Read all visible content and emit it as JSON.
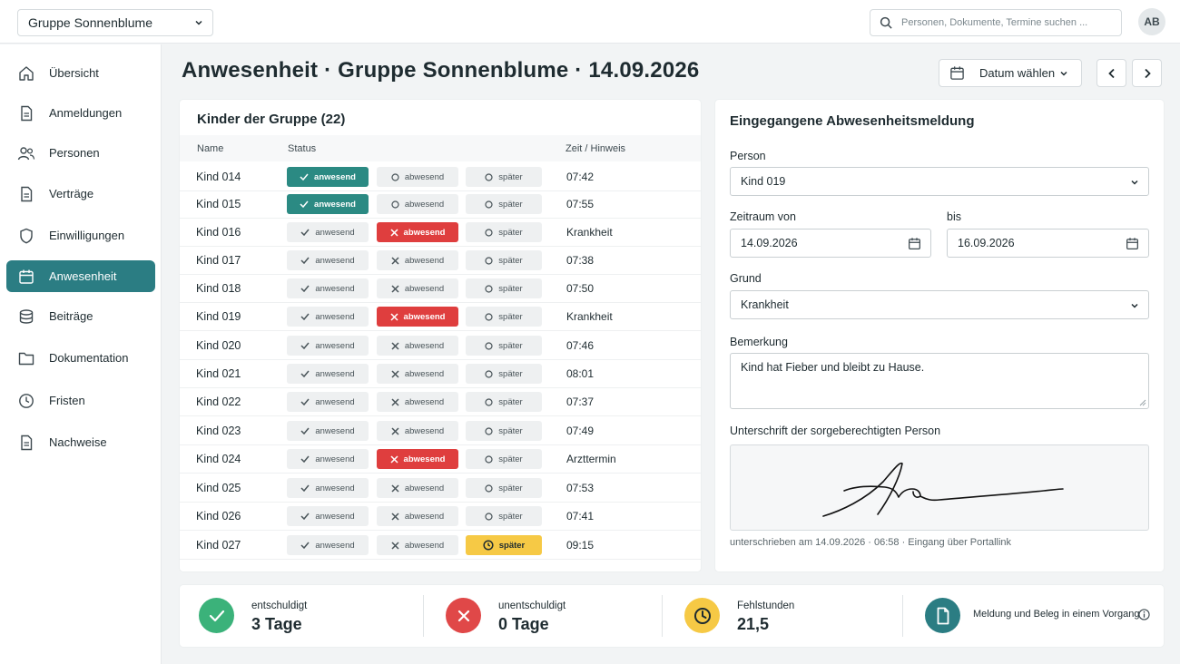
{
  "topbar": {
    "group_select": "Gruppe Sonnenblume",
    "search_placeholder": "Personen, Dokumente, Termine suchen ...",
    "avatar": "AB"
  },
  "sidebar": {
    "items": [
      {
        "label": "Übersicht",
        "icon": "home-icon"
      },
      {
        "label": "Anmeldungen",
        "icon": "document-icon"
      },
      {
        "label": "Personen",
        "icon": "users-icon"
      },
      {
        "label": "Verträge",
        "icon": "document-icon"
      },
      {
        "label": "Einwilligungen",
        "icon": "shield-icon"
      },
      {
        "label": "Anwesenheit",
        "icon": "calendar-icon",
        "active": true
      },
      {
        "label": "Beiträge",
        "icon": "coins-icon"
      },
      {
        "label": "Dokumentation",
        "icon": "folder-icon"
      },
      {
        "label": "Fristen",
        "icon": "clock-icon"
      },
      {
        "label": "Nachweise",
        "icon": "document-icon"
      }
    ]
  },
  "header": {
    "title": "Anwesenheit · Gruppe Sonnenblume · 14.09.2026",
    "date_button": "Datum wählen"
  },
  "children": {
    "title": "Kinder der Gruppe (22)",
    "columns": {
      "name": "Name",
      "status": "Status",
      "time": "Zeit / Hinweis"
    },
    "labels": {
      "present": "anwesend",
      "absent": "abwesend",
      "late": "später"
    },
    "rows": [
      {
        "name": "Kind 014",
        "status": "anwesend",
        "time": "07:42"
      },
      {
        "name": "Kind 015",
        "status": "anwesend",
        "time": "07:55"
      },
      {
        "name": "Kind 016",
        "status": "abwesend",
        "time": "Krankheit"
      },
      {
        "name": "Kind 017",
        "status": "",
        "time": "07:38"
      },
      {
        "name": "Kind 018",
        "status": "",
        "time": "07:50"
      },
      {
        "name": "Kind 019",
        "status": "abwesend",
        "time": "Krankheit"
      },
      {
        "name": "Kind 020",
        "status": "",
        "time": "07:46"
      },
      {
        "name": "Kind 021",
        "status": "",
        "time": "08:01"
      },
      {
        "name": "Kind 022",
        "status": "",
        "time": "07:37"
      },
      {
        "name": "Kind 023",
        "status": "",
        "time": "07:49"
      },
      {
        "name": "Kind 024",
        "status": "abwesend",
        "time": "Arzttermin"
      },
      {
        "name": "Kind 025",
        "status": "",
        "time": "07:53"
      },
      {
        "name": "Kind 026",
        "status": "",
        "time": "07:41"
      },
      {
        "name": "Kind 027",
        "status": "später",
        "time": "09:15"
      }
    ]
  },
  "absence": {
    "title": "Eingegangene Abwesenheitsmeldung",
    "person_label": "Person",
    "person_value": "Kind 019",
    "from_label": "Zeitraum von",
    "from_value": "14.09.2026",
    "to_label": "bis",
    "to_value": "16.09.2026",
    "reason_label": "Grund",
    "reason_value": "Krankheit",
    "remark_label": "Bemerkung",
    "remark_value": "Kind hat Fieber und bleibt zu Hause.",
    "signature_label": "Unterschrift der sorgeberechtigten Person",
    "signature_note": "unterschrieben am 14.09.2026 · 06:58 · Eingang über Portallink"
  },
  "stats": [
    {
      "label": "entschuldigt",
      "value": "3 Tage",
      "icon": "check-icon",
      "color": "#3bb27a"
    },
    {
      "label": "unentschuldigt",
      "value": "0 Tage",
      "icon": "x-icon",
      "color": "#e04848"
    },
    {
      "label": "Fehlstunden",
      "value": "21,5",
      "icon": "clock-icon",
      "color": "#f6c945"
    },
    {
      "label": "",
      "value": "",
      "icon": "document-icon",
      "color": "#2b7d83"
    }
  ],
  "stats_note": "Meldung und Beleg in einem Vorgang",
  "colors": {
    "accent": "#2b7d83",
    "present": "#2b8a83",
    "absent": "#df3e3e",
    "late": "#f6c945"
  }
}
